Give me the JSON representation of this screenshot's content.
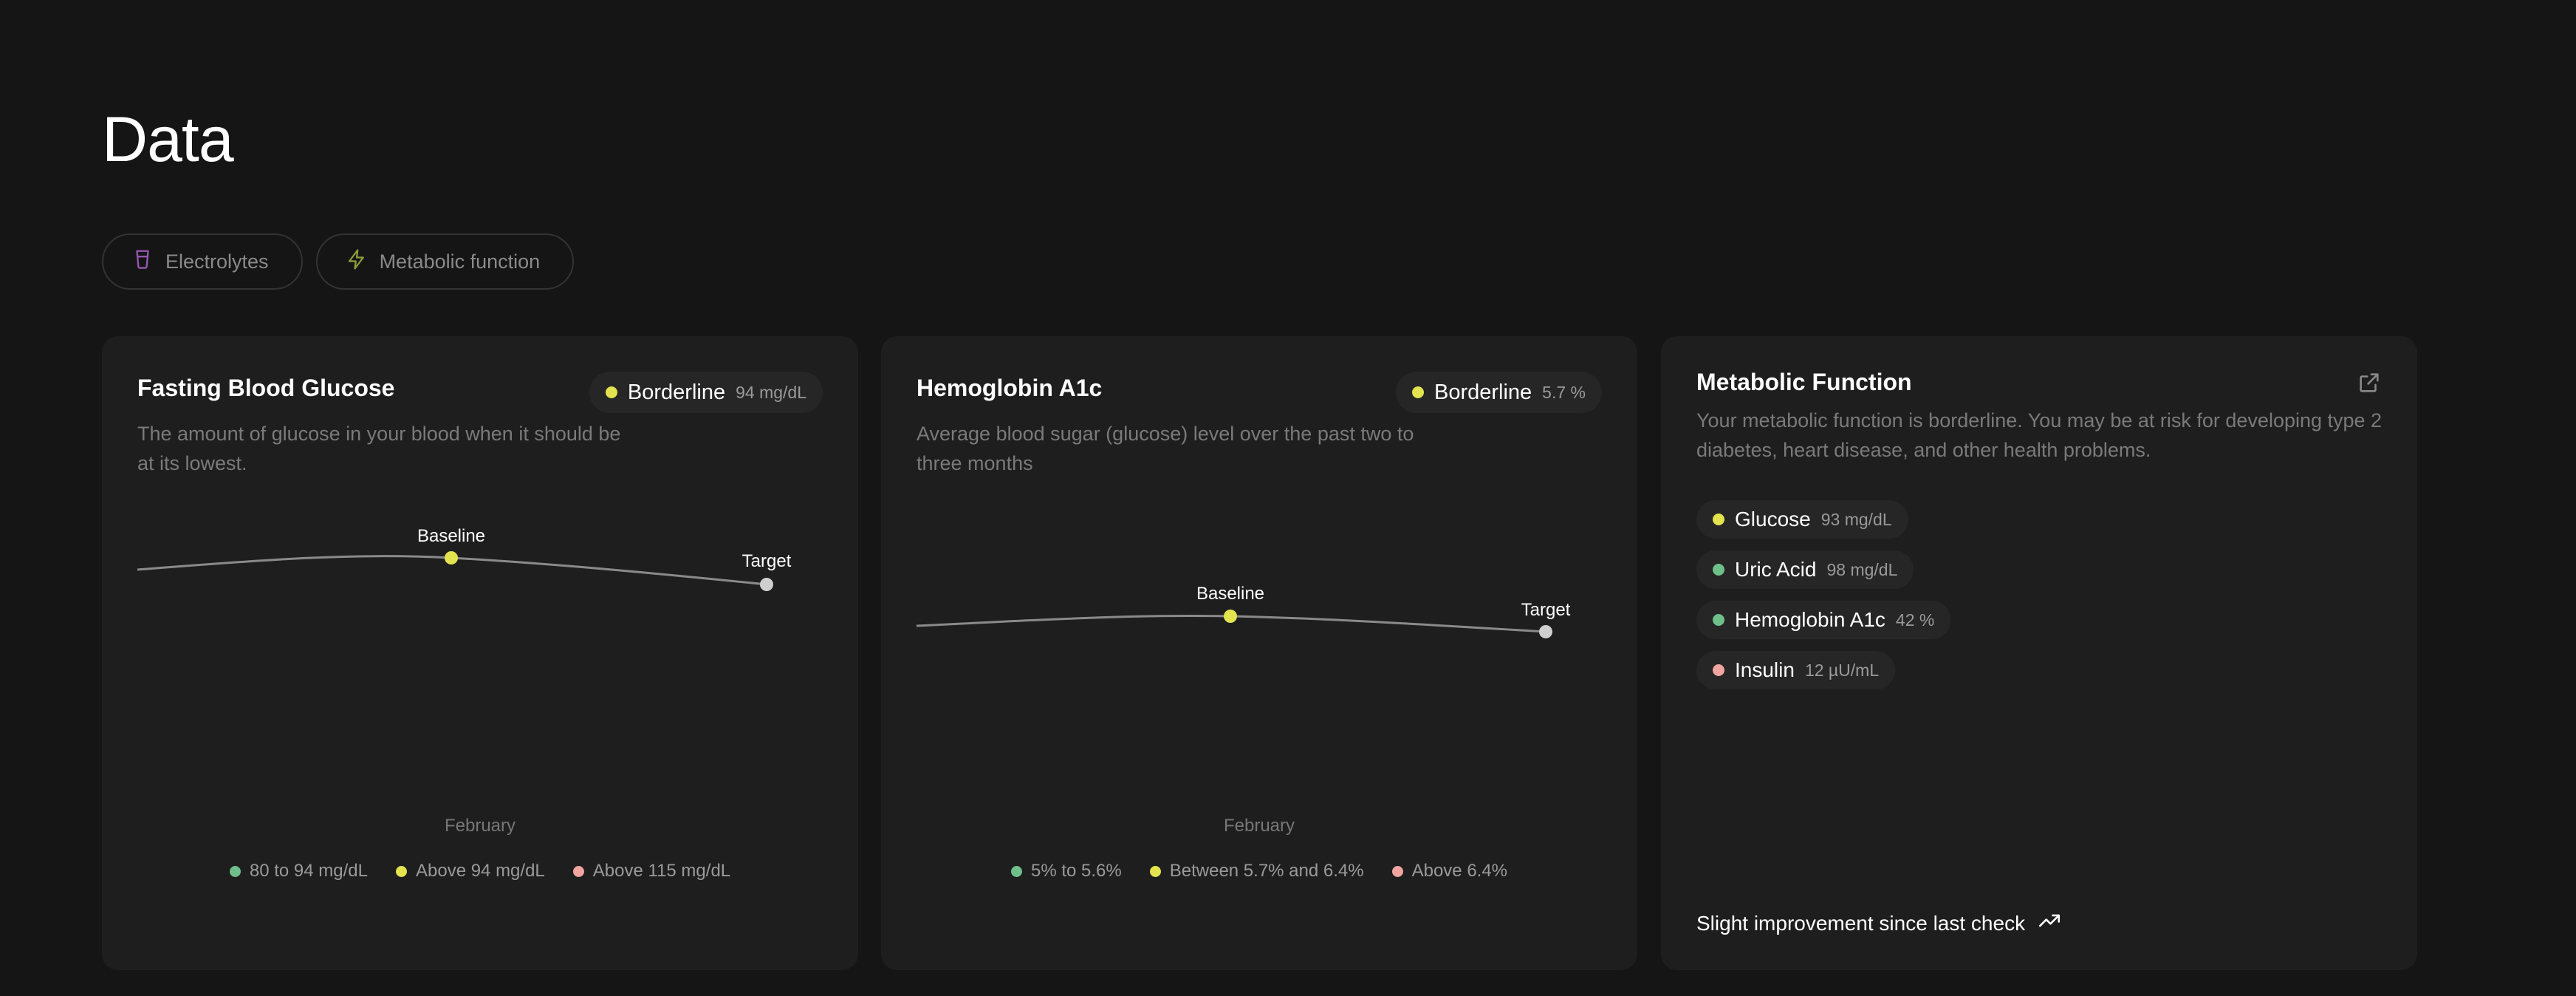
{
  "page": {
    "title": "Data"
  },
  "filters": [
    {
      "label": "Electrolytes",
      "icon": "cup-icon",
      "icon_color": "#9b59b6"
    },
    {
      "label": "Metabolic function",
      "icon": "bolt-icon",
      "icon_color": "#8fa03a"
    }
  ],
  "colors": {
    "background": "#151515",
    "card": "#1e1e1e",
    "green": "#6fbf8a",
    "yellow": "#e3e34f",
    "pink": "#f0a5a0",
    "target": "#cfcfcf"
  },
  "cards": {
    "glucose": {
      "title": "Fasting Blood Glucose",
      "description": "The amount of glucose in your blood when it should be at its lowest.",
      "status": {
        "label": "Borderline",
        "value": "94 mg/dL",
        "color": "#e3e34f"
      },
      "month": "February",
      "legend": [
        {
          "label": "80 to 94 mg/dL",
          "color": "#6fbf8a"
        },
        {
          "label": "Above 94 mg/dL",
          "color": "#e3e34f"
        },
        {
          "label": "Above 115 mg/dL",
          "color": "#f0a5a0"
        }
      ]
    },
    "a1c": {
      "title": "Hemoglobin A1c",
      "description": "Average blood sugar (glucose) level over the past two to three months",
      "status": {
        "label": "Borderline",
        "value": "5.7 %",
        "color": "#e3e34f"
      },
      "month": "February",
      "legend": [
        {
          "label": "5% to 5.6%",
          "color": "#6fbf8a"
        },
        {
          "label": "Between 5.7% and 6.4%",
          "color": "#e3e34f"
        },
        {
          "label": "Above 6.4%",
          "color": "#f0a5a0"
        }
      ]
    },
    "metabolic": {
      "title": "Metabolic Function",
      "description": "Your metabolic function is borderline. You may be at risk for developing type 2 diabetes, heart disease, and other health problems.",
      "biomarkers": [
        {
          "name": "Glucose",
          "value": "93 mg/dL",
          "color": "#e3e34f"
        },
        {
          "name": "Uric Acid",
          "value": "98 mg/dL",
          "color": "#6fbf8a"
        },
        {
          "name": "Hemoglobin A1c",
          "value": "42 %",
          "color": "#6fbf8a"
        },
        {
          "name": "Insulin",
          "value": "12 µU/mL",
          "color": "#f0a5a0"
        }
      ],
      "footer": "Slight improvement since last check",
      "footer_icon": "trend-up-icon",
      "link_icon": "external-link-icon"
    }
  },
  "chart_data": [
    {
      "type": "line",
      "title": "Fasting Blood Glucose",
      "points": [
        {
          "label": "Baseline",
          "color": "#e3e34f"
        },
        {
          "label": "Target",
          "color": "#cfcfcf"
        }
      ],
      "x_label": "February"
    },
    {
      "type": "line",
      "title": "Hemoglobin A1c",
      "points": [
        {
          "label": "Baseline",
          "color": "#e3e34f"
        },
        {
          "label": "Target",
          "color": "#cfcfcf"
        }
      ],
      "x_label": "February"
    }
  ]
}
